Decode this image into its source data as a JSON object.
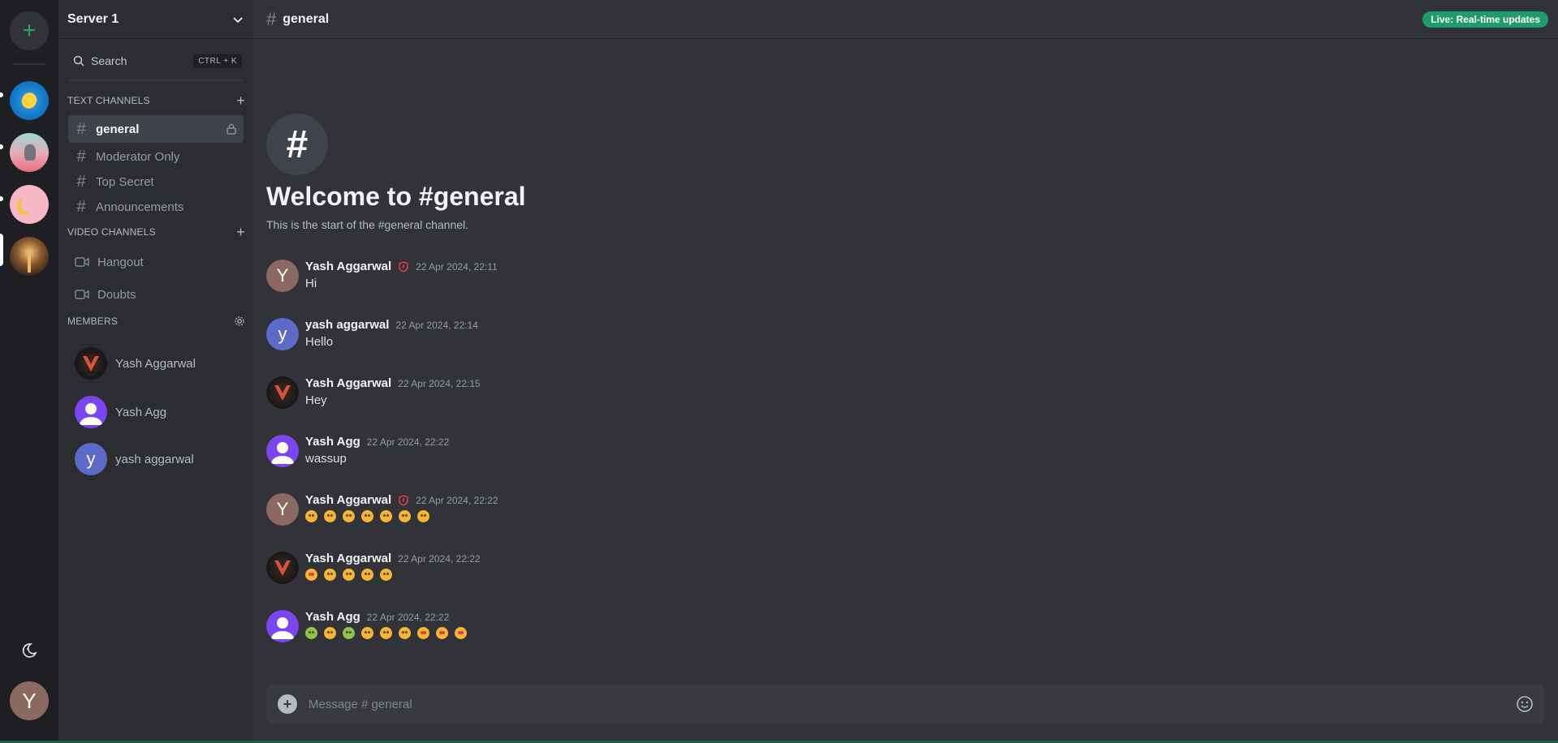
{
  "server": {
    "name": "Server 1"
  },
  "search": {
    "label": "Search",
    "shortcut": "CTRL + K"
  },
  "sections": {
    "text": "TEXT CHANNELS",
    "video": "VIDEO CHANNELS",
    "members": "MEMBERS"
  },
  "text_channels": [
    "general",
    "Moderator Only",
    "Top Secret",
    "Announcements"
  ],
  "video_channels": [
    "Hangout",
    "Doubts"
  ],
  "members": [
    "Yash Aggarwal",
    "Yash Agg",
    "yash aggarwal"
  ],
  "channel": {
    "name": "general"
  },
  "live_badge": "Live: Real-time updates",
  "welcome": {
    "title": "Welcome to #general",
    "subtitle": "This is the start of the #general channel."
  },
  "messages": [
    {
      "author": "Yash Aggarwal",
      "time": "22 Apr 2024, 22:11",
      "text": "Hi"
    },
    {
      "author": "yash aggarwal",
      "time": "22 Apr 2024, 22:14",
      "text": "Hello"
    },
    {
      "author": "Yash Aggarwal",
      "time": "22 Apr 2024, 22:15",
      "text": "Hey"
    },
    {
      "author": "Yash Agg",
      "time": "22 Apr 2024, 22:22",
      "text": "wassup"
    },
    {
      "author": "Yash Aggarwal",
      "time": "22 Apr 2024, 22:22",
      "text": ""
    },
    {
      "author": "Yash Aggarwal",
      "time": "22 Apr 2024, 22:22",
      "text": ""
    },
    {
      "author": "Yash Agg",
      "time": "22 Apr 2024, 22:22",
      "text": ""
    }
  ],
  "avatar_letters": {
    "Y": "Y",
    "y": "y"
  },
  "composer": {
    "placeholder": "Message # general"
  },
  "colors": {
    "accent_green": "#23a55a",
    "live_badge": "#1e9c6a",
    "moderator_shield": "#f23f43"
  }
}
